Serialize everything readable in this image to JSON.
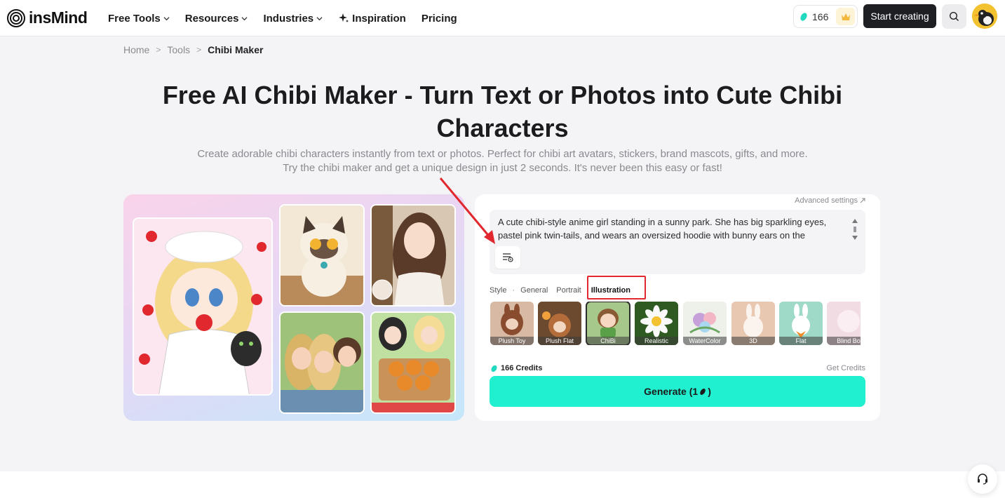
{
  "header": {
    "logo_text": "insMind",
    "nav": [
      {
        "label": "Free Tools",
        "has_chevron": true
      },
      {
        "label": "Resources",
        "has_chevron": true
      },
      {
        "label": "Industries",
        "has_chevron": true
      },
      {
        "label": "Inspiration",
        "icon": "sparkle-icon"
      },
      {
        "label": "Pricing"
      }
    ],
    "credits": "166",
    "start_label": "Start creating"
  },
  "breadcrumb": {
    "items": [
      "Home",
      "Tools"
    ],
    "current": "Chibi Maker"
  },
  "hero": {
    "title": "Free AI Chibi Maker - Turn Text or Photos into Cute Chibi Characters",
    "subtitle": "Create adorable chibi characters instantly from text or photos. Perfect for chibi art avatars, stickers, brand mascots, gifts, and more. Try the chibi maker and get a unique design in just 2 seconds. It's never been this easy or fast!"
  },
  "panel": {
    "advanced_label": "Advanced settings",
    "prompt": "A cute chibi-style anime girl standing in a sunny park. She has big sparkling eyes, pastel pink twin-tails, and wears an oversized hoodie with bunny ears on the",
    "style_label": "Style",
    "style_tabs": [
      "General",
      "Portrait",
      "Illustration"
    ],
    "active_tab": "Illustration",
    "styles": [
      {
        "label": "Plush Toy",
        "color": "#c9a08a"
      },
      {
        "label": "Plush Flat",
        "color": "#b87a4e"
      },
      {
        "label": "ChiBi",
        "color": "#8fb56b",
        "selected": true
      },
      {
        "label": "Realistic",
        "color": "#3f6b2d"
      },
      {
        "label": "WaterColor",
        "color": "#c9d9c4"
      },
      {
        "label": "3D",
        "color": "#e8c6b0"
      },
      {
        "label": "Flat",
        "color": "#9fd9c8"
      },
      {
        "label": "Blind Bo",
        "color": "#ecd3dc"
      }
    ],
    "credits_label": "166 Credits",
    "get_credits_label": "Get Credits",
    "generate_label": "Generate (1",
    "generate_suffix": ")"
  },
  "colors": {
    "accent": "#20f0cf",
    "dark_button": "#1e1f23",
    "highlight_red": "#e0282e"
  }
}
